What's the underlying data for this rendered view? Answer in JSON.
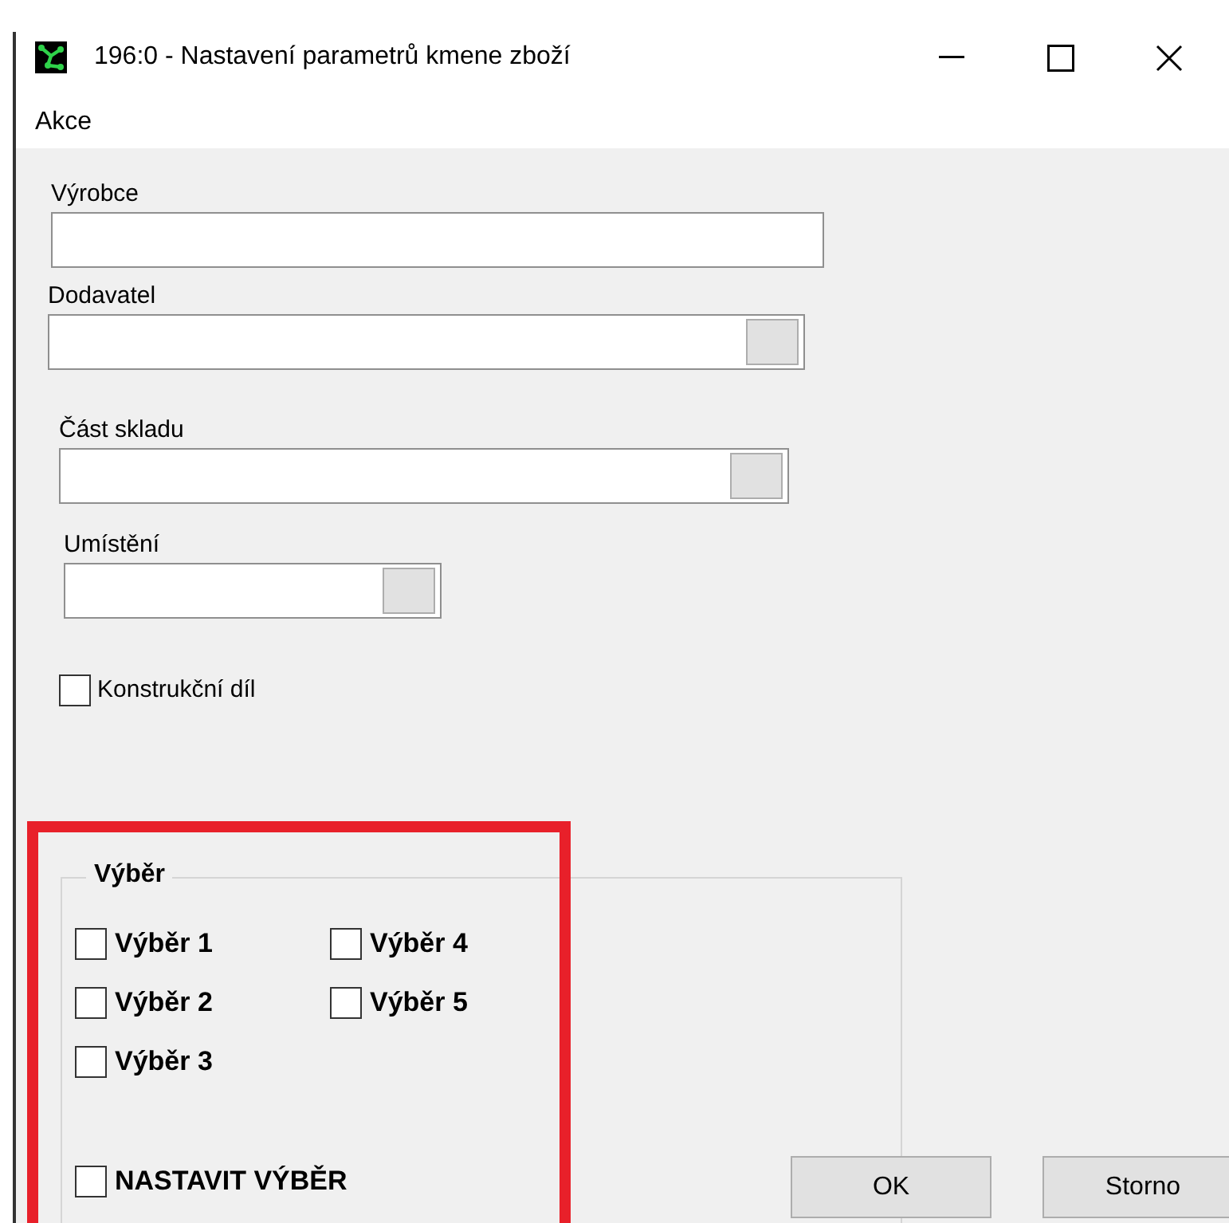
{
  "window": {
    "title": "196:0 - Nastavení parametrů kmene zboží"
  },
  "menu": [
    "Akce"
  ],
  "fields": [
    {
      "label": "Výrobce",
      "kind": "text"
    },
    {
      "label": "Dodavatel",
      "kind": "lookup"
    },
    {
      "label": "Část skladu",
      "kind": "lookup"
    },
    {
      "label": "Umístění",
      "kind": "lookup"
    }
  ],
  "checkbox": {
    "label": "Konstrukční díl",
    "checked": false
  },
  "selection_group": {
    "title": "Výběr",
    "options": [
      {
        "label": "Výběr 1",
        "checked": false
      },
      {
        "label": "Výběr 4",
        "checked": false
      },
      {
        "label": "Výběr 2",
        "checked": false
      },
      {
        "label": "Výběr 5",
        "checked": false
      },
      {
        "label": "Výběr 3",
        "checked": false
      }
    ],
    "set_selection": {
      "label": "NASTAVIT VÝBĚR",
      "checked": false
    }
  },
  "buttons": [
    "OK",
    "Storno"
  ]
}
